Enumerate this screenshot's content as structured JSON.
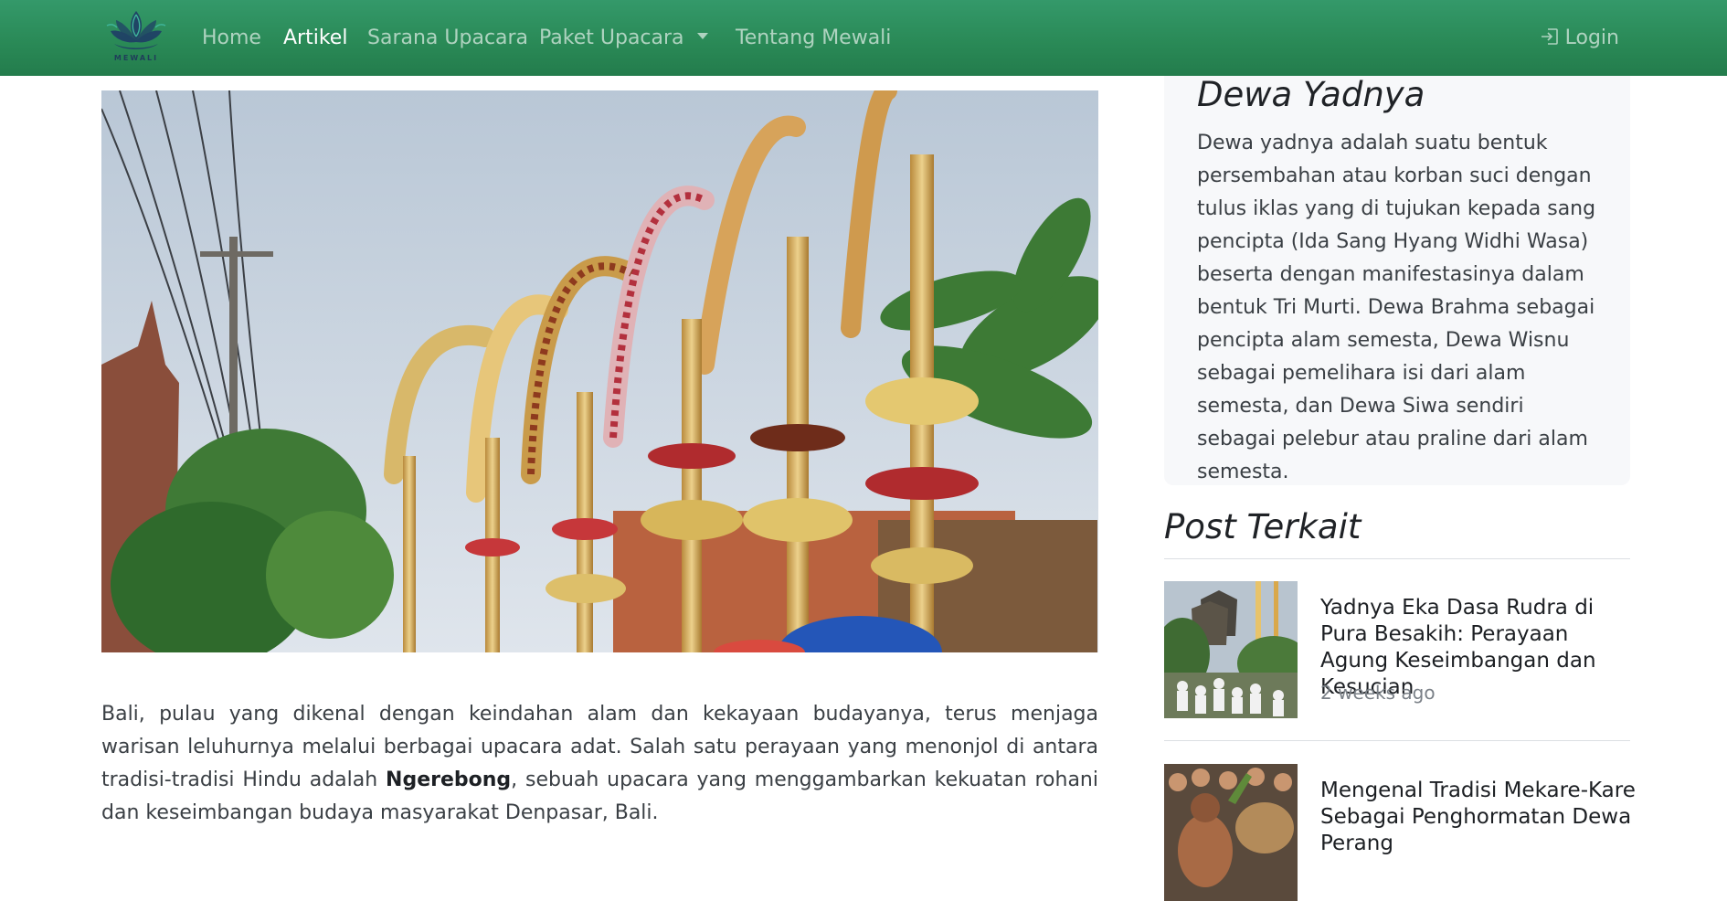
{
  "brand": {
    "name": "MEWALI"
  },
  "nav": {
    "items": [
      {
        "label": "Home"
      },
      {
        "label": "Artikel"
      },
      {
        "label": "Sarana Upacara"
      },
      {
        "label": "Paket Upacara"
      },
      {
        "label": "Tentang Mewali"
      }
    ],
    "login": "Login"
  },
  "article": {
    "hero_icon": "penjor-photo",
    "text_before": "Bali, pulau yang dikenal dengan keindahan alam dan kekayaan budayanya, terus menjaga warisan leluhurnya melalui berbagai upacara adat. Salah satu perayaan yang menonjol di antara tradisi-tradisi Hindu adalah ",
    "text_bold": "Ngerebong",
    "text_after": ", sebuah upacara yang menggambarkan kekuatan rohani dan keseimbangan budaya masyarakat Denpasar, Bali."
  },
  "sidebar": {
    "card": {
      "title": "Dewa Yadnya",
      "text": "Dewa yadnya adalah suatu bentuk persembahan atau korban suci dengan tulus iklas yang di tujukan kepada sang pencipta (Ida Sang Hyang Widhi Wasa) beserta dengan manifestasinya dalam bentuk Tri Murti. Dewa Brahma sebagai pencipta alam semesta, Dewa Wisnu sebagai pemelihara isi dari alam semesta, dan Dewa Siwa sendiri sebagai pelebur atau praline dari alam semesta."
    },
    "related_title": "Post Terkait",
    "posts": [
      {
        "title": "Yadnya Eka Dasa Rudra di Pura Besakih: Perayaan Agung Keseimbangan dan Kesucian",
        "meta": "2 weeks ago"
      },
      {
        "title": "Mengenal Tradisi Mekare-Kare Sebagai Penghormatan Dewa Perang",
        "meta": ""
      }
    ]
  },
  "colors": {
    "navbar": "#2a8a57",
    "card_bg": "#f7f8fa"
  }
}
